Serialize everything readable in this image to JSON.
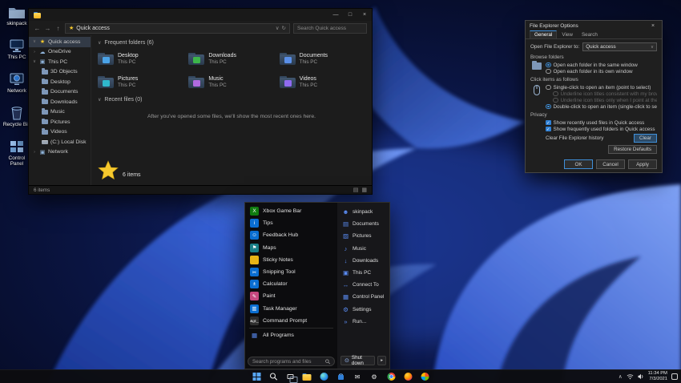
{
  "icons": {
    "star": "★",
    "cloud": "☁",
    "monitor": "▣",
    "chevron_down": "∨",
    "chevron_right": "›",
    "chevron_up": "∧",
    "back": "←",
    "forward": "→",
    "up": "↑",
    "refresh": "↻",
    "minimize": "—",
    "maximize": "□",
    "close": "×",
    "view_list": "▤",
    "view_grid": "▦",
    "check": "✓",
    "power": "⊙",
    "submenu": "▸",
    "mail": "✉",
    "gear": "⚙"
  },
  "desktop_icons": [
    {
      "label": "skinpack"
    },
    {
      "label": "This PC"
    },
    {
      "label": "Network"
    },
    {
      "label": "Recycle Bin"
    },
    {
      "label": "Control Panel"
    }
  ],
  "explorer": {
    "address": "Quick access",
    "search_placeholder": "Search Quick access",
    "sidebar_items": [
      {
        "label": "Quick access"
      },
      {
        "label": "OneDrive"
      },
      {
        "label": "This PC"
      },
      {
        "label": "3D Objects"
      },
      {
        "label": "Desktop"
      },
      {
        "label": "Documents"
      },
      {
        "label": "Downloads"
      },
      {
        "label": "Music"
      },
      {
        "label": "Pictures"
      },
      {
        "label": "Videos"
      },
      {
        "label": "(C:) Local Disk"
      },
      {
        "label": "Network"
      }
    ],
    "frequent_header": "Frequent folders (6)",
    "tiles": [
      {
        "name": "Desktop",
        "location": "This PC",
        "accent": "#4aa3e8"
      },
      {
        "name": "Downloads",
        "location": "This PC",
        "accent": "#3db54a"
      },
      {
        "name": "Documents",
        "location": "This PC",
        "accent": "#5a8fe8"
      },
      {
        "name": "Pictures",
        "location": "This PC",
        "accent": "#2fb7cc"
      },
      {
        "name": "Music",
        "location": "This PC",
        "accent": "#b06ae0"
      },
      {
        "name": "Videos",
        "location": "This PC",
        "accent": "#8f6af0"
      }
    ],
    "recent_header": "Recent files (0)",
    "recent_empty": "After you've opened some files, we'll show the most recent ones here.",
    "overlay_count": "6 items",
    "status_items": "6 items"
  },
  "dialog": {
    "title": "File Explorer Options",
    "tabs": [
      {
        "label": "General"
      },
      {
        "label": "View"
      },
      {
        "label": "Search"
      }
    ],
    "open_to_label": "Open File Explorer to:",
    "open_to_value": "Quick access",
    "browse_folders": {
      "title": "Browse folders",
      "options": [
        {
          "label": "Open each folder in the same window"
        },
        {
          "label": "Open each folder in its own window"
        }
      ]
    },
    "click_items": {
      "title": "Click items as follows",
      "options": [
        {
          "label": "Single-click to open an item (point to select)"
        },
        {
          "label": "Underline icon titles consistent with my browser"
        },
        {
          "label": "Underline icon titles only when I point at them"
        },
        {
          "label": "Double-click to open an item (single-click to select)"
        }
      ]
    },
    "privacy": {
      "title": "Privacy",
      "checkboxes": [
        {
          "label": "Show recently used files in Quick access"
        },
        {
          "label": "Show frequently used folders in Quick access"
        }
      ],
      "clear_label": "Clear File Explorer history",
      "clear_button": "Clear"
    },
    "restore_defaults": "Restore Defaults",
    "buttons": {
      "ok": "OK",
      "cancel": "Cancel",
      "apply": "Apply"
    }
  },
  "start_menu": {
    "apps": [
      {
        "label": "Xbox Game Bar",
        "glyph": "X",
        "color": "#107c10"
      },
      {
        "label": "Tips",
        "glyph": "i",
        "color": "#0a6ed1"
      },
      {
        "label": "Feedback Hub",
        "glyph": "☺",
        "color": "#0a6ed1"
      },
      {
        "label": "Maps",
        "glyph": "⚑",
        "color": "#1a7f87"
      },
      {
        "label": "Sticky Notes",
        "glyph": "",
        "color": "#e7b416"
      },
      {
        "label": "Snipping Tool",
        "glyph": "✂",
        "color": "#0a6ed1"
      },
      {
        "label": "Calculator",
        "glyph": "±",
        "color": "#0a6ed1"
      },
      {
        "label": "Paint",
        "glyph": "✎",
        "color": "#c6487f"
      },
      {
        "label": "Task Manager",
        "glyph": "▥",
        "color": "#0a6ed1"
      },
      {
        "label": "Command Prompt",
        "glyph": "&gt;_",
        "color": "#2e2e2e"
      }
    ],
    "all_programs": "All Programs",
    "search_placeholder": "Search programs and files",
    "places": [
      {
        "label": "skinpack",
        "glyph": "☻"
      },
      {
        "label": "Documents",
        "glyph": "▤"
      },
      {
        "label": "Pictures",
        "glyph": "▨"
      },
      {
        "label": "Music",
        "glyph": "♪"
      },
      {
        "label": "Downloads",
        "glyph": "↓"
      },
      {
        "label": "This PC",
        "glyph": "▣"
      },
      {
        "label": "Connect To",
        "glyph": "↔"
      },
      {
        "label": "Control Panel",
        "glyph": "▦"
      },
      {
        "label": "Settings",
        "glyph": "⚙"
      },
      {
        "label": "Run...",
        "glyph": "»"
      }
    ],
    "shutdown": "Shut down"
  },
  "taskbar": {
    "tray_time": "11:34 PM",
    "tray_date": "7/3/2021"
  }
}
